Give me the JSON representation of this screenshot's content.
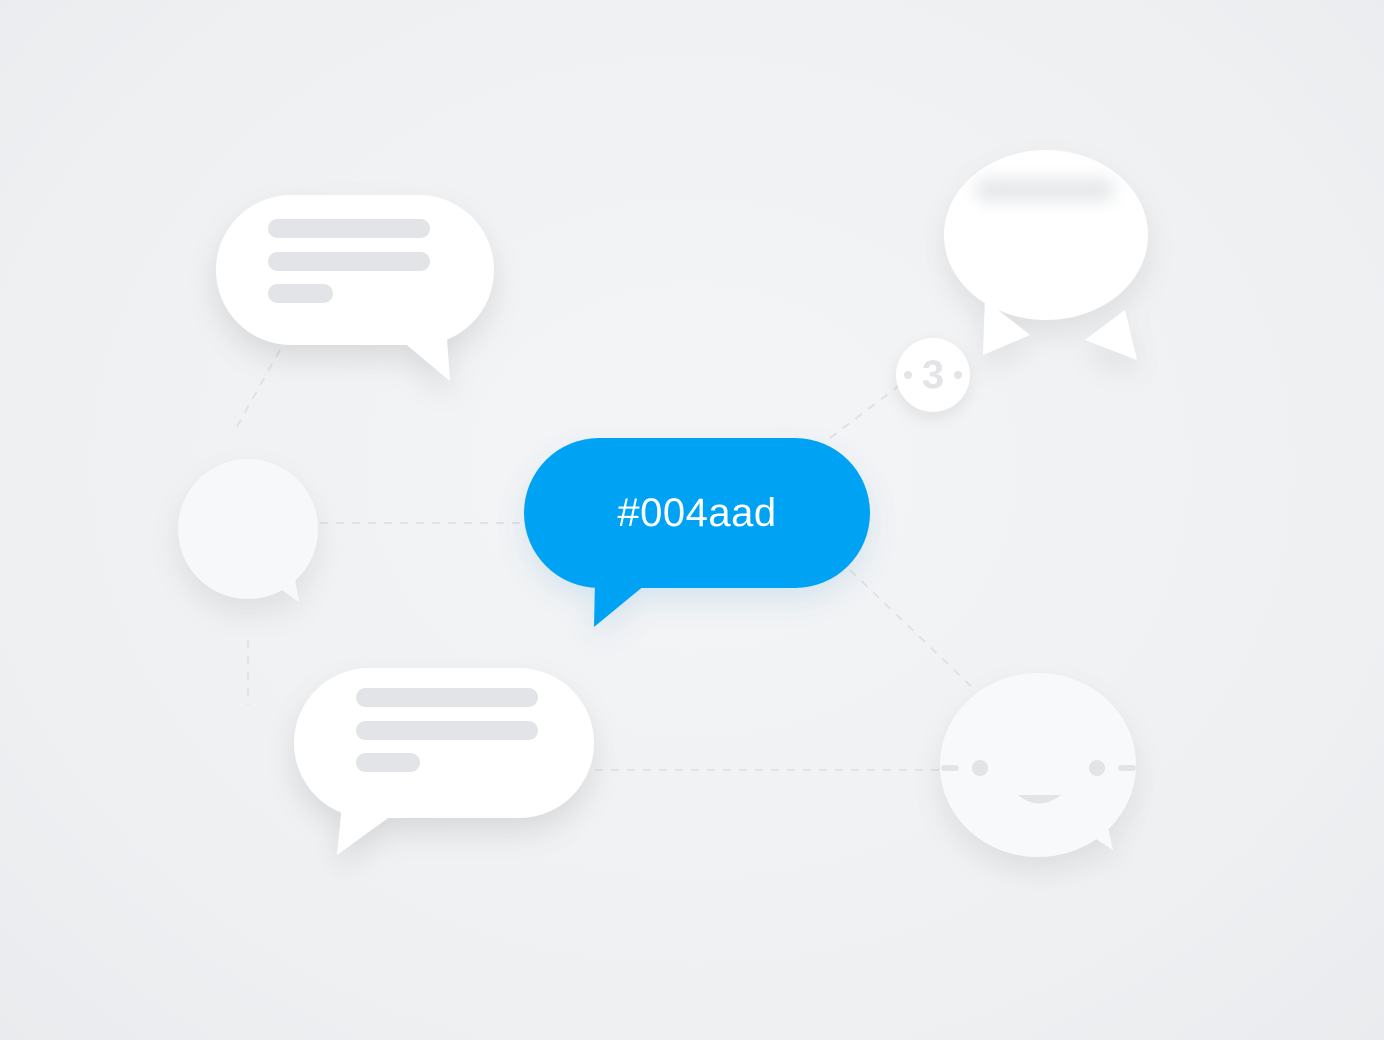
{
  "hero_bubble": {
    "label": "#004aad",
    "color": "#06a2f4"
  },
  "badge": {
    "value": "3"
  },
  "icons": {
    "top_left": "message-lines-icon",
    "left": "chat-bubble-icon",
    "bottom_left": "message-lines-icon",
    "top_right": "chat-bubble-icon",
    "bottom_right": "smiley-chat-icon"
  },
  "colors": {
    "background": "#eef0f2",
    "bubble": "#ffffff",
    "placeholder_line": "#e2e4e8",
    "accent": "#06a2f4"
  }
}
